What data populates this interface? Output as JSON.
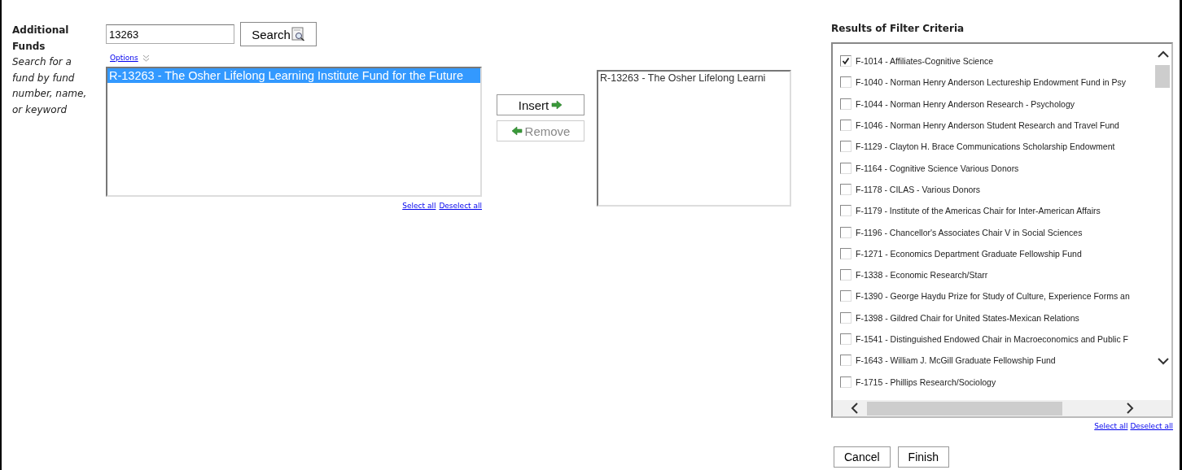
{
  "label": {
    "title": "Additional Funds",
    "hint": "Search for a fund by fund number, name, or keyword"
  },
  "search": {
    "value": "13263",
    "button": "Search"
  },
  "options_link": "Options",
  "available": {
    "items": [
      {
        "text": "R-13263 - The Osher Lifelong Learning Institute Fund for the Future",
        "selected": true
      }
    ],
    "select_all": "Select all",
    "deselect_all": "Deselect all"
  },
  "actions": [
    {
      "label": "Insert",
      "kind": "insert",
      "disabled": false
    },
    {
      "label": "Remove",
      "kind": "remove",
      "disabled": true
    }
  ],
  "chosen": {
    "items": [
      {
        "text": "R-13263 - The Osher Lifelong Learni",
        "selected": false
      }
    ]
  },
  "results": {
    "title": "Results of Filter Criteria",
    "select_all": "Select all",
    "deselect_all": "Deselect all",
    "items": [
      {
        "text": "F-1014 - Affiliates-Cognitive Science",
        "checked": true
      },
      {
        "text": "F-1040 - Norman Henry Anderson Lectureship Endowment Fund in Psy",
        "checked": false
      },
      {
        "text": "F-1044 - Norman Henry Anderson Research - Psychology",
        "checked": false
      },
      {
        "text": "F-1046 - Norman Henry Anderson Student Research and Travel Fund",
        "checked": false
      },
      {
        "text": "F-1129 - Clayton H. Brace Communications Scholarship Endowment",
        "checked": false
      },
      {
        "text": "F-1164 - Cognitive Science Various Donors",
        "checked": false
      },
      {
        "text": "F-1178 - CILAS - Various Donors",
        "checked": false
      },
      {
        "text": "F-1179 - Institute of the Americas Chair for Inter-American Affairs",
        "checked": false
      },
      {
        "text": "F-1196 - Chancellor's Associates Chair V in Social Sciences",
        "checked": false
      },
      {
        "text": "F-1271 - Economics Department Graduate Fellowship Fund",
        "checked": false
      },
      {
        "text": "F-1338 - Economic Research/Starr",
        "checked": false
      },
      {
        "text": "F-1390 - George Haydu Prize for Study of Culture, Experience Forms an",
        "checked": false
      },
      {
        "text": "F-1398 - Gildred Chair for United States-Mexican Relations",
        "checked": false
      },
      {
        "text": "F-1541 - Distinguished Endowed Chair in Macroeconomics and Public F",
        "checked": false
      },
      {
        "text": "F-1643 - William J. McGill Graduate Fellowship Fund",
        "checked": false
      },
      {
        "text": "F-1715 - Phillips Research/Sociology",
        "checked": false
      }
    ]
  },
  "footer_buttons": [
    "Cancel",
    "Finish"
  ]
}
